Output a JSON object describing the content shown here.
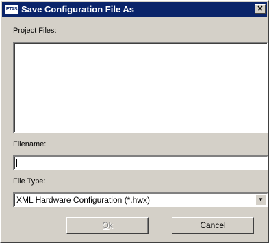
{
  "window": {
    "title": "Save Configuration File As",
    "app_icon_text": "ETAS",
    "close_glyph": "✕"
  },
  "project_files": {
    "label": "Project Files:",
    "items": []
  },
  "filename": {
    "label": "Filename:",
    "value": ""
  },
  "file_type": {
    "label": "File Type:",
    "selected": "XML Hardware Configuration (*.hwx)"
  },
  "buttons": {
    "ok_mnemonic": "O",
    "ok_rest": "k",
    "ok_enabled": false,
    "cancel_mnemonic": "C",
    "cancel_rest": "ancel"
  }
}
